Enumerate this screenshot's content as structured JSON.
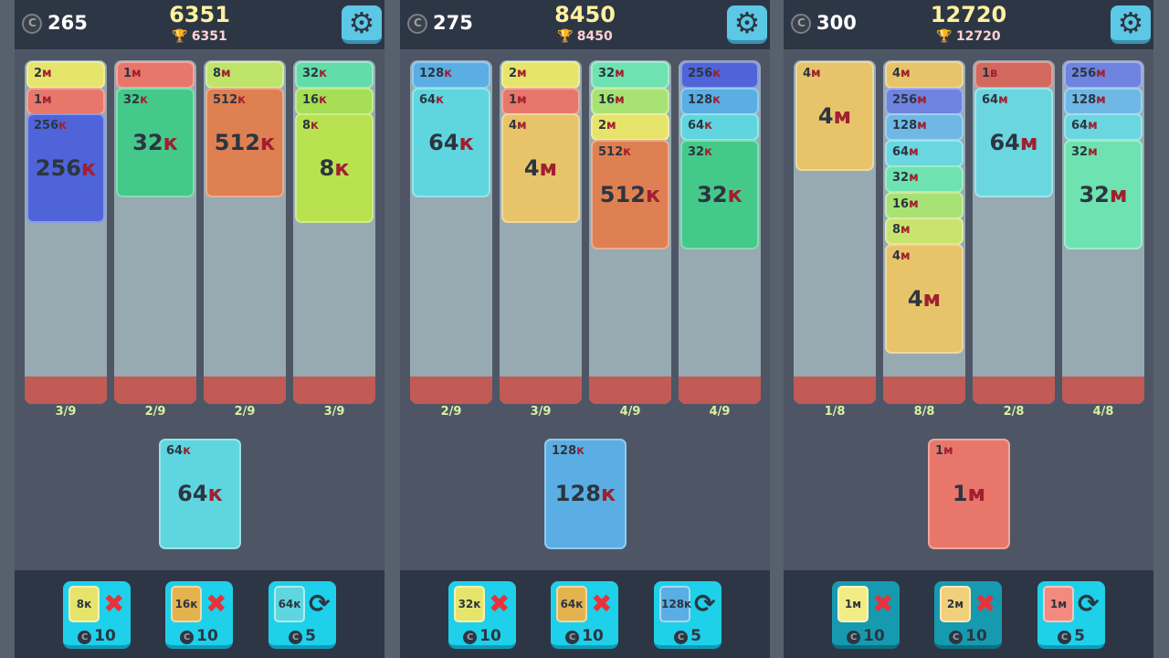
{
  "panels": [
    {
      "coins": "265",
      "score": "6351",
      "best": "6351",
      "columns": [
        {
          "count": "3/9",
          "cards": [
            {
              "small": "2м",
              "color": "#e7e46b"
            },
            {
              "small": "1м",
              "color": "#e8776b"
            },
            {
              "small": "256к",
              "big": "256к",
              "color": "#4f64d8"
            }
          ]
        },
        {
          "count": "2/9",
          "cards": [
            {
              "small": "1м",
              "color": "#e8776b"
            },
            {
              "small": "32к",
              "big": "32к",
              "color": "#44c98b"
            }
          ]
        },
        {
          "count": "2/9",
          "cards": [
            {
              "small": "8м",
              "color": "#bfe46a"
            },
            {
              "small": "512к",
              "big": "512к",
              "color": "#df8053"
            }
          ]
        },
        {
          "count": "3/9",
          "cards": [
            {
              "small": "32к",
              "color": "#62dca8"
            },
            {
              "small": "16к",
              "color": "#a6df55"
            },
            {
              "small": "8к",
              "big": "8к",
              "color": "#b8e24f"
            }
          ]
        }
      ],
      "next": {
        "small": "64к",
        "big": "64к",
        "color": "#5fd6df"
      },
      "powerups": [
        {
          "chip": "8к",
          "chip_color": "#e7e46b",
          "icon": "close-icon",
          "cost": "10"
        },
        {
          "chip": "16к",
          "chip_color": "#e4b34f",
          "icon": "close-icon",
          "cost": "10"
        },
        {
          "chip": "64к",
          "chip_color": "#5fd6df",
          "icon": "swap-icon",
          "cost": "5"
        }
      ]
    },
    {
      "coins": "275",
      "score": "8450",
      "best": "8450",
      "columns": [
        {
          "count": "2/9",
          "cards": [
            {
              "small": "128к",
              "color": "#5aaee3"
            },
            {
              "small": "64к",
              "big": "64к",
              "color": "#5fd6df"
            }
          ]
        },
        {
          "count": "3/9",
          "cards": [
            {
              "small": "2м",
              "color": "#e7e46b"
            },
            {
              "small": "1м",
              "color": "#e8776b"
            },
            {
              "small": "4м",
              "big": "4м",
              "color": "#e7c46a"
            }
          ]
        },
        {
          "count": "4/9",
          "cards": [
            {
              "small": "32м",
              "color": "#6ee2b0"
            },
            {
              "small": "16м",
              "color": "#a9e274"
            },
            {
              "small": "2м",
              "color": "#e7e46b"
            },
            {
              "small": "512к",
              "big": "512к",
              "color": "#df8053"
            }
          ]
        },
        {
          "count": "4/9",
          "cards": [
            {
              "small": "256к",
              "color": "#4f64d8"
            },
            {
              "small": "128к",
              "color": "#5aaee3"
            },
            {
              "small": "64к",
              "color": "#5fd6df"
            },
            {
              "small": "32к",
              "big": "32к",
              "color": "#44c98b"
            }
          ]
        }
      ],
      "next": {
        "small": "128к",
        "big": "128к",
        "color": "#5aaee3"
      },
      "powerups": [
        {
          "chip": "32к",
          "chip_color": "#e7e46b",
          "icon": "close-icon",
          "cost": "10"
        },
        {
          "chip": "64к",
          "chip_color": "#e4b34f",
          "icon": "close-icon",
          "cost": "10"
        },
        {
          "chip": "128к",
          "chip_color": "#5aaee3",
          "icon": "swap-icon",
          "cost": "5"
        }
      ]
    },
    {
      "coins": "300",
      "score": "12720",
      "best": "12720",
      "columns": [
        {
          "count": "1/8",
          "cards": [
            {
              "small": "4м",
              "big": "4м",
              "color": "#e7c46a"
            }
          ]
        },
        {
          "count": "8/8",
          "cards": [
            {
              "small": "4м",
              "color": "#e7c46a"
            },
            {
              "small": "256м",
              "color": "#6f83e0"
            },
            {
              "small": "128м",
              "color": "#6fb8e6"
            },
            {
              "small": "64м",
              "color": "#6ad6e0"
            },
            {
              "small": "32м",
              "color": "#6ee2b0"
            },
            {
              "small": "16м",
              "color": "#a9e274"
            },
            {
              "small": "8м",
              "color": "#c9e46e"
            },
            {
              "small": "4м",
              "big": "4м",
              "color": "#e7c46a"
            }
          ]
        },
        {
          "count": "2/8",
          "cards": [
            {
              "small": "1в",
              "color": "#d2685e"
            },
            {
              "small": "64м",
              "big": "64м",
              "color": "#6ad6e0"
            }
          ]
        },
        {
          "count": "4/8",
          "cards": [
            {
              "small": "256м",
              "color": "#6f83e0"
            },
            {
              "small": "128м",
              "color": "#6fb8e6"
            },
            {
              "small": "64м",
              "color": "#6ad6e0"
            },
            {
              "small": "32м",
              "big": "32м",
              "color": "#6ee2b0"
            }
          ]
        }
      ],
      "next": {
        "small": "1м",
        "big": "1м",
        "color": "#e8776b"
      },
      "powerups": [
        {
          "chip": "1м",
          "chip_color": "#f2ec86",
          "icon": "close-icon",
          "cost": "10"
        },
        {
          "chip": "2м",
          "chip_color": "#f0d07a",
          "icon": "close-icon",
          "cost": "10"
        },
        {
          "chip": "1м",
          "chip_color": "#f28a80",
          "icon": "swap-icon",
          "cost": "5"
        }
      ]
    }
  ],
  "colors": {
    "background": "#4e5665",
    "topbar": "#2d3645",
    "column": "#97aab2",
    "column_base": "#c25a55",
    "score": "#fff1a0",
    "powerup": "#1ed0ea"
  }
}
